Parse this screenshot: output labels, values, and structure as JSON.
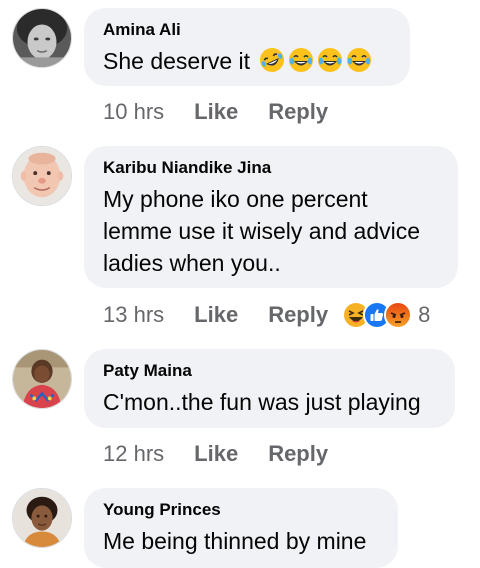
{
  "comments": [
    {
      "author": "Amina Ali",
      "text": "She deserve it",
      "text_emojis": [
        "rolling-laughing",
        "tears-of-joy",
        "tears-of-joy",
        "tears-of-joy"
      ],
      "time": "10 hrs",
      "like": "Like",
      "reply": "Reply"
    },
    {
      "author": "Karibu Niandike Jina",
      "text_lines": [
        "My phone iko one percent",
        "lemme use it wisely and advice",
        "ladies when you.."
      ],
      "time": "13 hrs",
      "like": "Like",
      "reply": "Reply",
      "reactions": [
        "haha",
        "like",
        "angry"
      ],
      "reaction_count": "8"
    },
    {
      "author": "Paty Maina",
      "text": "C'mon..the fun was just playing",
      "time": "12 hrs",
      "like": "Like",
      "reply": "Reply"
    },
    {
      "author": "Young Princes",
      "text": "Me being thinned by mine"
    }
  ],
  "colors": {
    "bubble": "#f0f2f5",
    "meta": "#65676b",
    "like_reaction": "#1877f2",
    "angry_reaction": "#e9710f",
    "haha_reaction": "#f7b125"
  }
}
